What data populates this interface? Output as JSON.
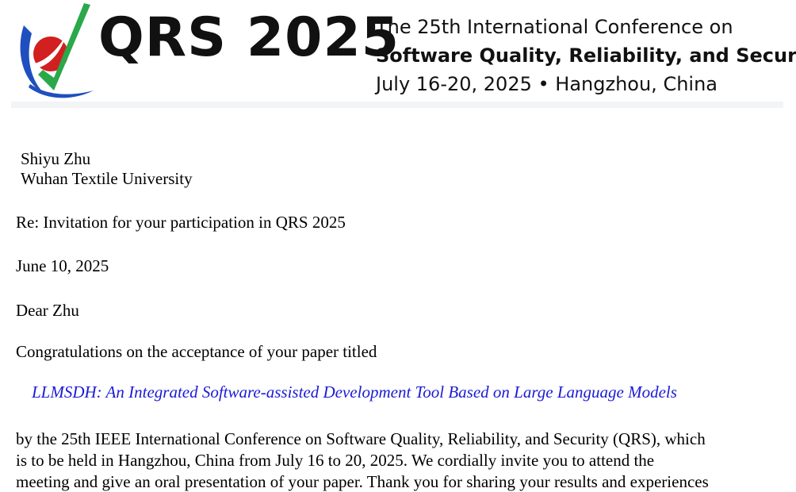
{
  "banner": {
    "logo_text": "QRS 2025",
    "line1": "The 25th International Conference on",
    "line2": "Software Quality, Reliability, and Security",
    "line3": "July 16-20, 2025 •  Hangzhou, China",
    "logo_colors": {
      "red": "#d21f1f",
      "blue": "#1f4fbf",
      "green": "#2aa84a"
    }
  },
  "letter": {
    "recipient_name": "Shiyu Zhu",
    "recipient_org": "Wuhan Textile University",
    "subject": "Re: Invitation for your participation in QRS 2025",
    "date": "June 10, 2025",
    "salutation": "Dear Zhu",
    "intro": "Congratulations on the acceptance of your paper titled",
    "paper_title": "LLMSDH: An Integrated Software-assisted Development Tool Based on Large Language Models",
    "body_lines": [
      "by the 25th IEEE International Conference on Software Quality, Reliability, and Security (QRS), which",
      "is to be held in Hangzhou, China from July 16 to 20, 2025. We cordially invite you to attend the",
      "meeting and give an oral presentation of your paper. Thank you for sharing your results and experiences"
    ]
  }
}
